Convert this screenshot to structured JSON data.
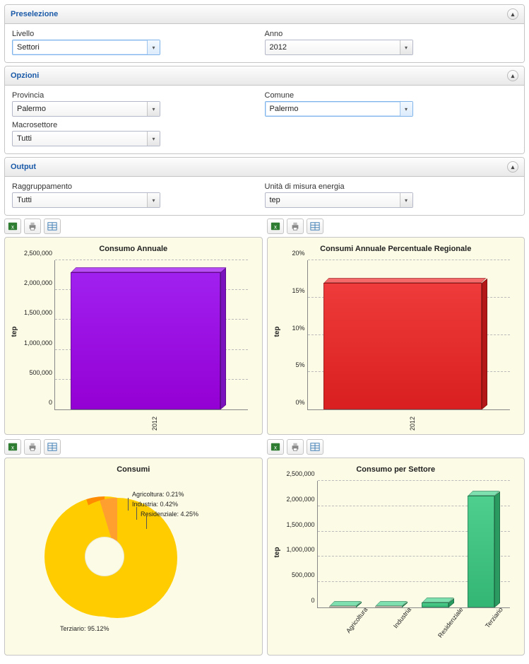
{
  "panels": {
    "preselezione": {
      "title": "Preselezione",
      "fields": {
        "livello": {
          "label": "Livello",
          "value": "Settori"
        },
        "anno": {
          "label": "Anno",
          "value": "2012"
        }
      }
    },
    "opzioni": {
      "title": "Opzioni",
      "fields": {
        "provincia": {
          "label": "Provincia",
          "value": "Palermo"
        },
        "comune": {
          "label": "Comune",
          "value": "Palermo"
        },
        "macrosettore": {
          "label": "Macrosettore",
          "value": "Tutti"
        }
      }
    },
    "output": {
      "title": "Output",
      "fields": {
        "raggruppamento": {
          "label": "Raggruppamento",
          "value": "Tutti"
        },
        "unita": {
          "label": "Unità di misura energia",
          "value": "tep"
        }
      }
    }
  },
  "toolbar_icons": [
    "excel-icon",
    "print-icon",
    "table-icon"
  ],
  "charts": {
    "consumo_annuale": {
      "title": "Consumo Annuale",
      "ylabel": "tep",
      "y_ticks": [
        "0",
        "500,000",
        "1,000,000",
        "1,500,000",
        "2,000,000",
        "2,500,000"
      ]
    },
    "consumi_percentuale": {
      "title": "Consumi Annuale Percentuale Regionale",
      "ylabel": "tep",
      "y_ticks": [
        "0%",
        "5%",
        "10%",
        "15%",
        "20%"
      ]
    },
    "consumi_pie": {
      "title": "Consumi",
      "labels": {
        "agricoltura": "Agricoltura: 0.21%",
        "industria": "Industria: 0.42%",
        "residenziale": "Residenziale: 4.25%",
        "terziario": "Terziario: 95.12%"
      }
    },
    "consumo_settore": {
      "title": "Consumo per Settore",
      "ylabel": "tep",
      "y_ticks": [
        "0",
        "500,000",
        "1,000,000",
        "1,500,000",
        "2,000,000",
        "2,500,000"
      ],
      "x_ticks": [
        "Agricoltura",
        "Industria",
        "Residenziale",
        "Terziario"
      ]
    }
  },
  "chart_data": [
    {
      "type": "bar",
      "title": "Consumo Annuale",
      "xlabel": "",
      "ylabel": "tep",
      "categories": [
        "2012"
      ],
      "values": [
        2300000
      ],
      "ylim": [
        0,
        2500000
      ],
      "color": "#9b1fe8"
    },
    {
      "type": "bar",
      "title": "Consumi Annuale Percentuale Regionale",
      "xlabel": "",
      "ylabel": "tep",
      "categories": [
        "2012"
      ],
      "values": [
        17
      ],
      "value_unit": "%",
      "ylim": [
        0,
        20
      ],
      "color": "#e63232"
    },
    {
      "type": "pie",
      "title": "Consumi",
      "series": [
        {
          "name": "Agricoltura",
          "value": 0.21
        },
        {
          "name": "Industria",
          "value": 0.42
        },
        {
          "name": "Residenziale",
          "value": 4.25
        },
        {
          "name": "Terziario",
          "value": 95.12
        }
      ],
      "value_unit": "%",
      "colors": {
        "Terziario": "#ffcc00",
        "Agricoltura": "#ff8c00",
        "Industria": "#ff8c00",
        "Residenziale": "#ff8c00"
      },
      "donut": true
    },
    {
      "type": "bar",
      "title": "Consumo per Settore",
      "xlabel": "",
      "ylabel": "tep",
      "categories": [
        "Agricoltura",
        "Industria",
        "Residenziale",
        "Terziario"
      ],
      "values": [
        5000,
        10000,
        100000,
        2200000
      ],
      "ylim": [
        0,
        2500000
      ],
      "color": "#3fbd7f"
    }
  ]
}
